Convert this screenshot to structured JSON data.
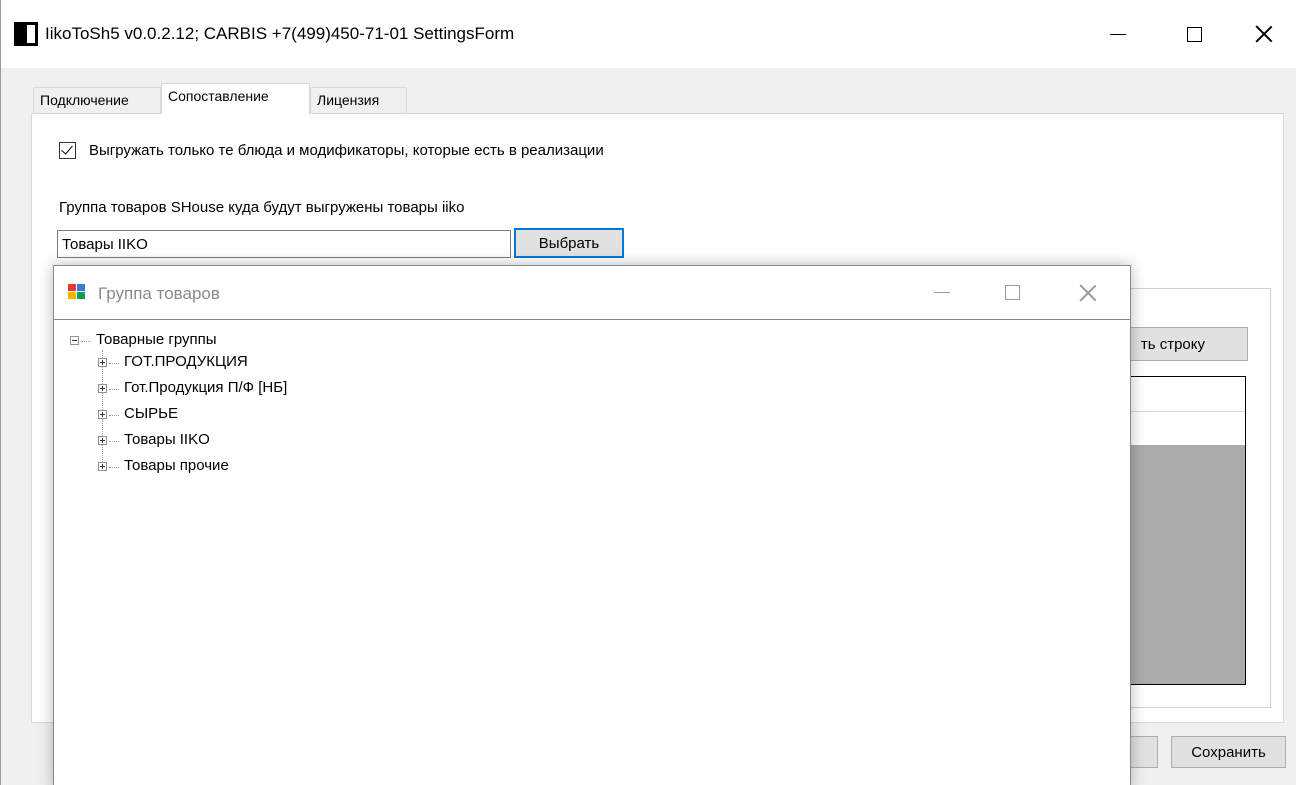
{
  "window": {
    "title": "IikoToSh5 v0.0.2.12;  CARBIS +7(499)450-71-01 SettingsForm"
  },
  "tabs": [
    {
      "label": "Подключение"
    },
    {
      "label": "Сопоставление"
    },
    {
      "label": "Лицензия"
    }
  ],
  "mapping": {
    "export_only_sold_label": "Выгружать только те блюда и модификаторы, которые есть в реализации",
    "export_only_sold_checked": true,
    "product_group_label": "Группа товаров SHouse куда будут выгружены товары iiko",
    "product_group_value": "Товары IIKO",
    "select_button": "Выбрать",
    "add_row_button": "ть строку",
    "grid_header": ":"
  },
  "footer": {
    "save_button": "Сохранить"
  },
  "dialog": {
    "title": "Группа товаров",
    "tree": {
      "root": "Товарные группы",
      "children": [
        "ГОТ.ПРОДУКЦИЯ",
        "Гот.Продукция П/Ф [НБ]",
        "СЫРЬЕ",
        "Товары IIKO",
        "Товары прочие"
      ]
    }
  },
  "colors": {
    "window_bg": "#f0f0f0",
    "focus_border": "#0078d7",
    "grid_bg": "#ababab",
    "dialog_title_inactive": "#8a8a8a"
  }
}
